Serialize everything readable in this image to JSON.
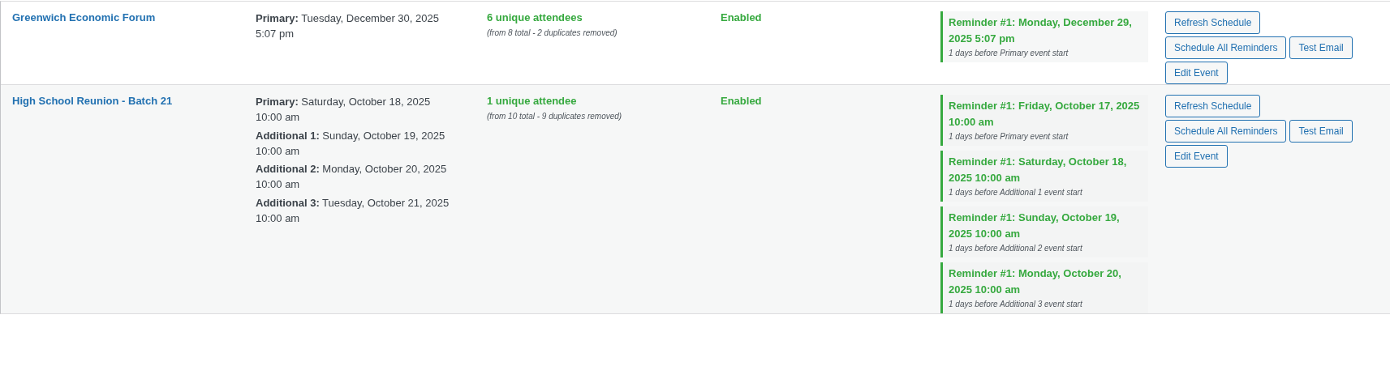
{
  "events": [
    {
      "name": "Greenwich Economic Forum",
      "dates": [
        "**Primary:** Tuesday, December 30, 2025 5:07 pm"
      ],
      "attendees": "6 unique attendees",
      "attendee_note": "(from 8 total - 2 duplicates removed)",
      "status": "Enabled",
      "reminders": [
        {
          "title": "Reminder #1: Monday, December 29, 2025 5:07 pm",
          "note": "1 days before Primary event start"
        }
      ],
      "buttons": [
        "Refresh Schedule",
        "Schedule All Reminders",
        "Test Email",
        "Edit Event"
      ]
    },
    {
      "name": "High School Reunion - Batch 21",
      "dates": [
        "**Primary:** Saturday, October 18, 2025 10:00 am",
        "**Additional 1:** Sunday, October 19, 2025 10:00 am",
        "**Additional 2:** Monday, October 20, 2025 10:00 am",
        "**Additional 3:** Tuesday, October 21, 2025 10:00 am"
      ],
      "attendees": "1 unique attendee",
      "attendee_note": "(from 10 total - 9 duplicates removed)",
      "status": "Enabled",
      "reminders": [
        {
          "title": "Reminder #1: Friday, October 17, 2025 10:00 am",
          "note": "1 days before Primary event start"
        },
        {
          "title": "Reminder #1: Saturday, October 18, 2025 10:00 am",
          "note": "1 days before Additional 1 event start"
        },
        {
          "title": "Reminder #1: Sunday, October 19, 2025 10:00 am",
          "note": "1 days before Additional 2 event start"
        },
        {
          "title": "Reminder #1: Monday, October 20, 2025 10:00 am",
          "note": "1 days before Additional 3 event start"
        }
      ],
      "buttons": [
        "Refresh Schedule",
        "Schedule All Reminders",
        "Test Email",
        "Edit Event"
      ]
    }
  ]
}
